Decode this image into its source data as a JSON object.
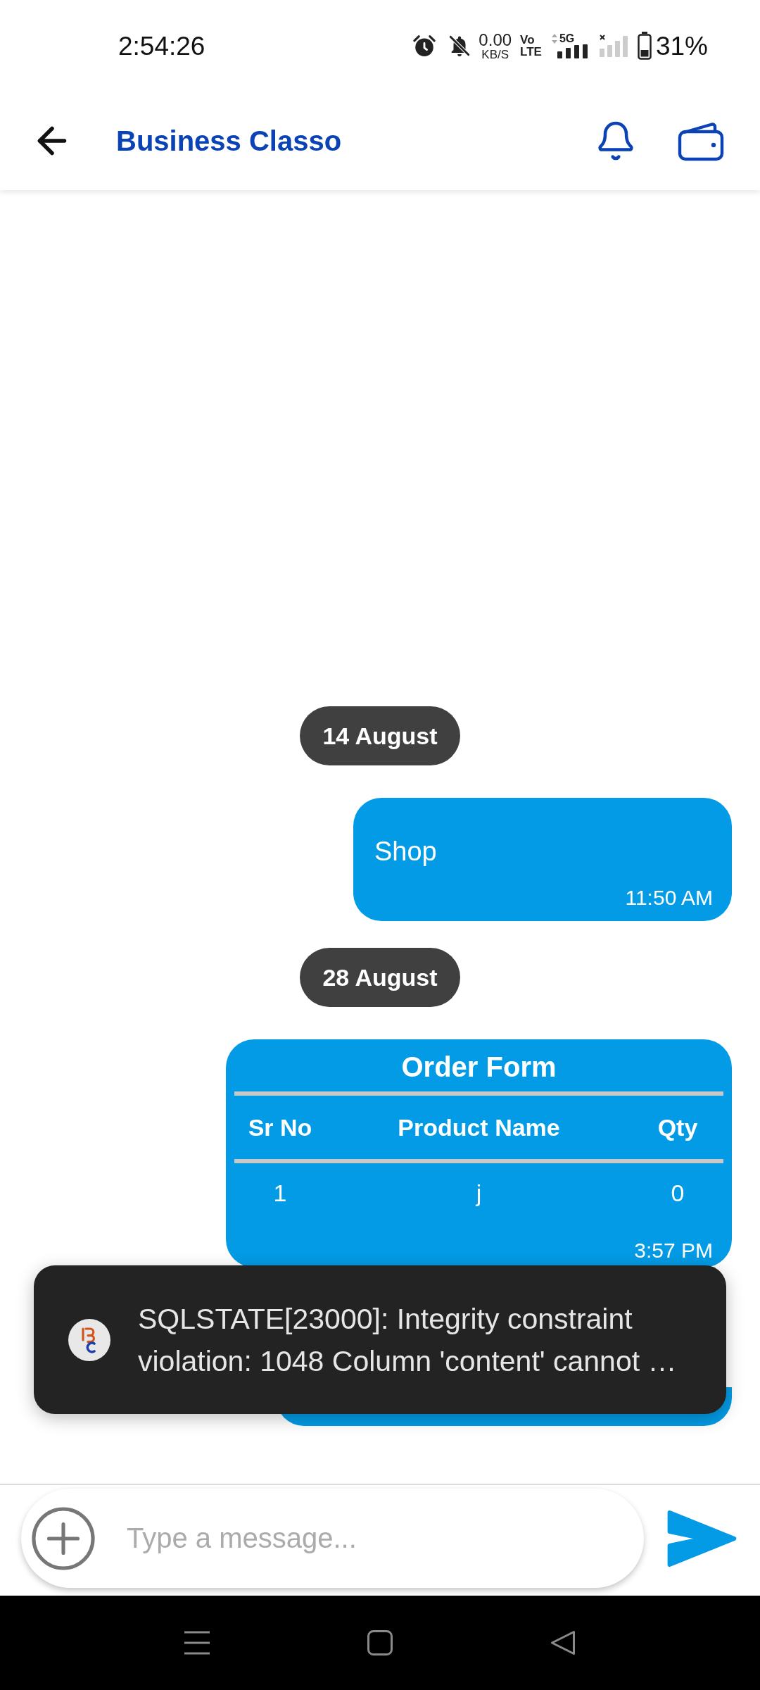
{
  "status_bar": {
    "time": "2:54:26",
    "data_rate": "0.00",
    "data_rate_unit": "KB/S",
    "volte_top": "Vo",
    "volte_bottom": "LTE",
    "network": "5G",
    "battery": "31%"
  },
  "header": {
    "title": "Business Classo"
  },
  "messages": [
    {
      "kind": "date",
      "text": "14 August"
    },
    {
      "kind": "text",
      "text": "Shop",
      "time": "11:50 AM"
    },
    {
      "kind": "date",
      "text": "28 August"
    },
    {
      "kind": "order",
      "title": "Order Form",
      "columns": [
        "Sr No",
        "Product Name",
        "Qty"
      ],
      "rows": [
        [
          "1",
          "j",
          "0"
        ]
      ],
      "time": "3:57 PM"
    },
    {
      "kind": "covered"
    }
  ],
  "toast": {
    "text": "SQLSTATE[23000]: Integrity constraint violation: 1048 Column 'content' cannot …"
  },
  "composer": {
    "placeholder": "Type a message..."
  }
}
